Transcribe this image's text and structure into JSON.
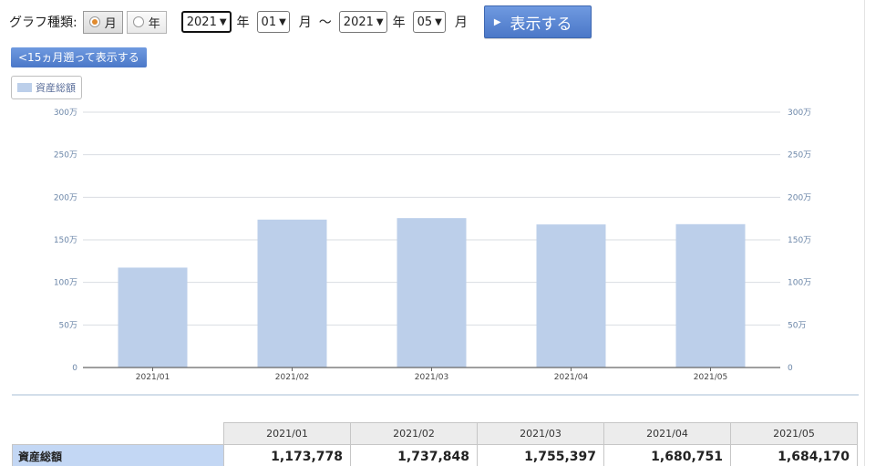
{
  "controls": {
    "graph_type_label": "グラフ種類:",
    "radio_month": "月",
    "radio_year": "年",
    "selected_type": "月",
    "from_year": "2021",
    "from_month": "01",
    "unit_year": "年",
    "unit_month": "月",
    "tilde": "〜",
    "to_year": "2021",
    "to_month": "05",
    "show_button": "表示する",
    "back_button": "<15ヵ月遡って表示する"
  },
  "legend": {
    "label": "資産総額"
  },
  "chart_data": {
    "type": "bar",
    "categories": [
      "2021/01",
      "2021/02",
      "2021/03",
      "2021/04",
      "2021/05"
    ],
    "series": [
      {
        "name": "資産総額",
        "values": [
          1173778,
          1737848,
          1755397,
          1680751,
          1684170
        ]
      }
    ],
    "ylim": [
      0,
      3000000
    ],
    "yticks": [
      0,
      500000,
      1000000,
      1500000,
      2000000,
      2500000,
      3000000
    ],
    "ytick_labels": [
      "0",
      "50万",
      "100万",
      "150万",
      "200万",
      "250万",
      "300万"
    ],
    "grid": true,
    "bar_color": "#bccfea"
  },
  "table": {
    "headers": [
      "2021/01",
      "2021/02",
      "2021/03",
      "2021/04",
      "2021/05"
    ],
    "row_label": "資産総額",
    "values": [
      "1,173,778",
      "1,737,848",
      "1,755,397",
      "1,680,751",
      "1,684,170"
    ]
  }
}
